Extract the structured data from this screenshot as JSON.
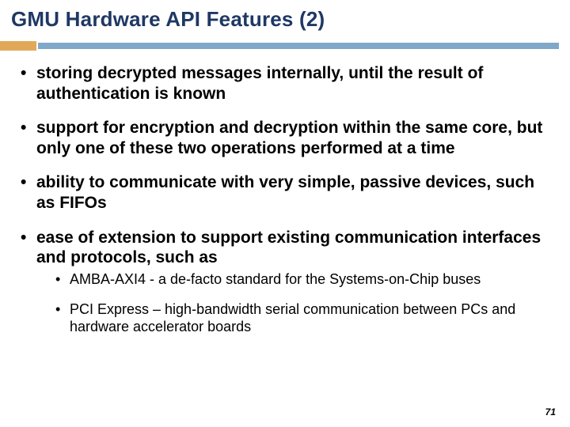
{
  "title": "GMU Hardware API Features (2)",
  "page_number": "71",
  "bullets": {
    "b0": "storing decrypted messages internally, until the result of authentication is known",
    "b1": "support for encryption and decryption within the same core, but only one of these two operations performed at a time",
    "b2": "ability to communicate with very simple, passive devices, such as FIFOs",
    "b3": "ease of extension to support existing communication interfaces and protocols, such as",
    "sub0": "AMBA-AXI4   - a de-facto standard for the Systems-on-Chip buses",
    "sub1": "PCI Express – high-bandwidth serial communication between PCs and hardware accelerator boards"
  },
  "accent": {
    "short_color": "#e0a95a",
    "long_color": "#7fa8c9",
    "title_color": "#1f3864"
  }
}
